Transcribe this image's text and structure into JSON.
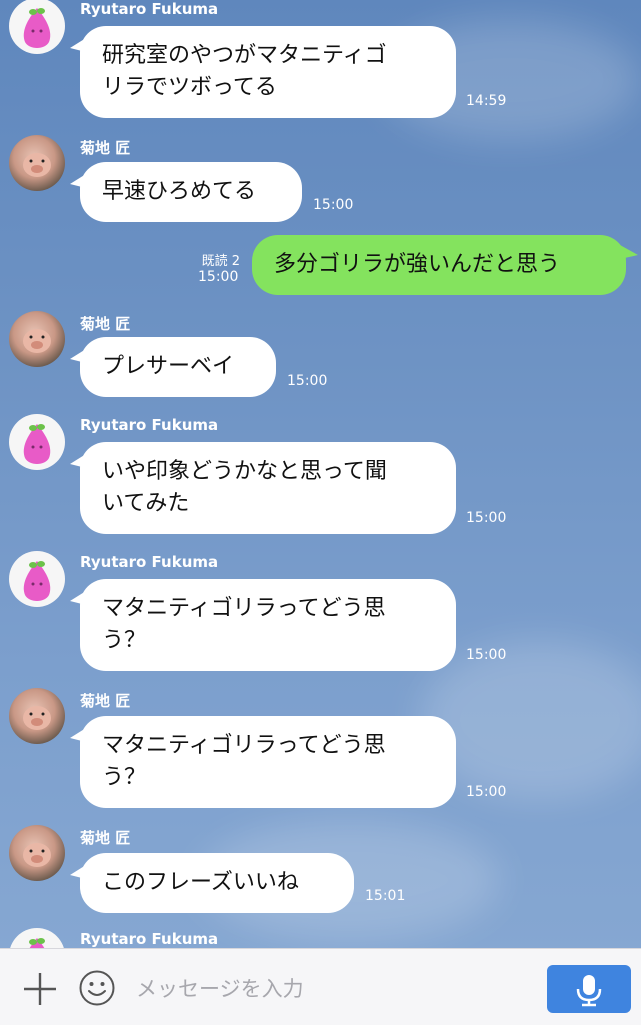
{
  "messages": [
    {
      "sender": "Ryutaro Fukuma",
      "avatar": "pink-mascot-avatar",
      "text": "研究室のやつがマタニティゴ\nリラでツボってる",
      "time": "14:59"
    },
    {
      "sender": "菊地 匠",
      "avatar": "pig-avatar",
      "text": "早速ひろめてる",
      "time": "15:00"
    },
    {
      "sender": "me",
      "read": "既読 2",
      "text": "多分ゴリラが強いんだと思う",
      "time": "15:00"
    },
    {
      "sender": "菊地 匠",
      "avatar": "pig-avatar",
      "text": "プレサーベイ",
      "time": "15:00"
    },
    {
      "sender": "Ryutaro Fukuma",
      "avatar": "pink-mascot-avatar",
      "text": "いや印象どうかなと思って聞\nいてみた",
      "time": "15:00"
    },
    {
      "sender": "Ryutaro Fukuma",
      "avatar": "pink-mascot-avatar",
      "text": "マタニティゴリラってどう思\nう？",
      "time": "15:00"
    },
    {
      "sender": "菊地 匠",
      "avatar": "pig-avatar",
      "text": "マタニティゴリラってどう思\nう？",
      "time": "15:00"
    },
    {
      "sender": "菊地 匠",
      "avatar": "pig-avatar",
      "text": "このフレーズいいね",
      "time": "15:01"
    },
    {
      "sender": "Ryutaro Fukuma",
      "avatar": "pink-mascot-avatar"
    }
  ],
  "input": {
    "placeholder": "メッセージを入力"
  },
  "icons": {
    "plus": "plus-icon",
    "emoji": "emoji-icon",
    "mic": "microphone-icon"
  },
  "colors": {
    "my_bubble": "#84e35e",
    "their_bubble": "#ffffff",
    "send_button": "#3f84df"
  }
}
